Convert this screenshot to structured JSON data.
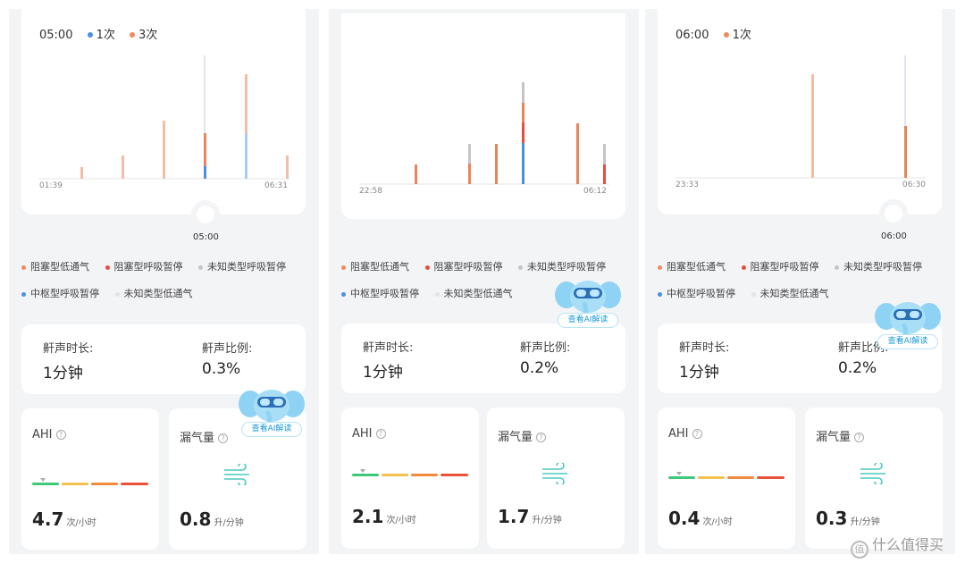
{
  "panels": [
    {
      "chart": {
        "time": "05:00",
        "legend": [
          {
            "label": "1次",
            "color": "#4a90e2"
          },
          {
            "label": "3次",
            "color": "#f08a5d"
          }
        ],
        "start_time": "01:39",
        "end_time": "06:31",
        "cursor_time": "05:00"
      },
      "legend": {
        "row1": [
          "阻塞型低通气",
          "阻塞型呼吸暂停",
          "未知类型呼吸暂停"
        ],
        "row2": [
          "中枢型呼吸暂停",
          "未知类型低通气"
        ]
      },
      "snore": {
        "duration_label": "鼾声时长:",
        "duration_value": "1分钟",
        "ratio_label": "鼾声比例:",
        "ratio_value": "0.3%"
      },
      "ahi": {
        "label": "AHI",
        "value": "4.7",
        "unit": "次/小时"
      },
      "leak": {
        "label": "漏气量",
        "value": "0.8",
        "unit": "升/分钟"
      },
      "ai_button": "查看AI解读"
    },
    {
      "chart": {
        "start_time": "22:58",
        "end_time": "06:12"
      },
      "legend": {
        "row1": [
          "阻塞型低通气",
          "阻塞型呼吸暂停",
          "未知类型呼吸暂停"
        ],
        "row2": [
          "中枢型呼吸暂停",
          "未知类型低通气"
        ]
      },
      "snore": {
        "duration_label": "鼾声时长:",
        "duration_value": "1分钟",
        "ratio_label": "鼾声比例:",
        "ratio_value": "0.2%"
      },
      "ahi": {
        "label": "AHI",
        "value": "2.1",
        "unit": "次/小时"
      },
      "leak": {
        "label": "漏气量",
        "value": "1.7",
        "unit": "升/分钟"
      },
      "ai_button": "查看AI解读"
    },
    {
      "chart": {
        "time": "06:00",
        "legend": [
          {
            "label": "1次",
            "color": "#f08a5d"
          }
        ],
        "start_time": "23:33",
        "end_time": "06:30",
        "cursor_time": "06:00"
      },
      "legend": {
        "row1": [
          "阻塞型低通气",
          "阻塞型呼吸暂停",
          "未知类型呼吸暂停"
        ],
        "row2": [
          "中枢型呼吸暂停",
          "未知类型低通气"
        ]
      },
      "snore": {
        "duration_label": "鼾声时长:",
        "duration_value": "1分钟",
        "ratio_label": "鼾声比例:",
        "ratio_value": "0.2%"
      },
      "ahi": {
        "label": "AHI",
        "value": "0.4",
        "unit": "次/小时"
      },
      "leak": {
        "label": "漏气量",
        "value": "0.3",
        "unit": "升/分钟"
      },
      "ai_button": "查看AI解读"
    }
  ],
  "legend_colors": {
    "obstructive_hypopnea": "#f08a5d",
    "obstructive_apnea": "#e84c3d",
    "unknown_apnea": "#c5c5c5",
    "central_apnea": "#4a90e2",
    "unknown_hypopnea": "#e4e4e4"
  },
  "ahi_scale_colors": [
    "#3ec87a",
    "#f2c14e",
    "#f08a3c",
    "#e8513a"
  ],
  "watermark": "什么值得买"
}
